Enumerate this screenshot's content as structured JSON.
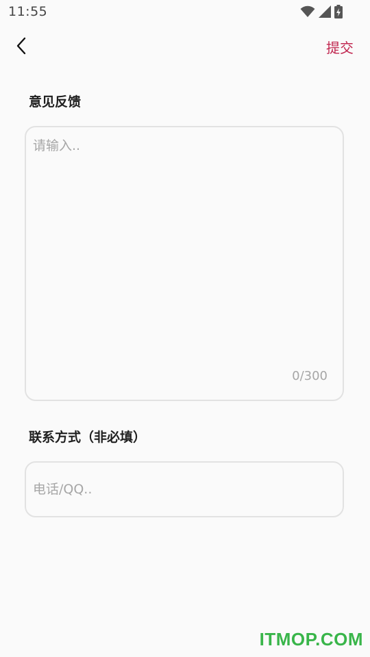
{
  "status_bar": {
    "time": "11:55",
    "icons": [
      "wifi-icon",
      "cell-signal-icon",
      "battery-charging-icon"
    ]
  },
  "header": {
    "back_icon": "chevron-left-icon",
    "submit_label": "提交",
    "accent_color": "#c0264f"
  },
  "feedback": {
    "title": "意见反馈",
    "placeholder": "请输入..",
    "value": "",
    "counter": "0/300"
  },
  "contact": {
    "title": "联系方式（非必填）",
    "placeholder": "电话/QQ..",
    "value": ""
  },
  "watermark": {
    "text": "ITMOP.COM",
    "color": "#39b54a"
  }
}
